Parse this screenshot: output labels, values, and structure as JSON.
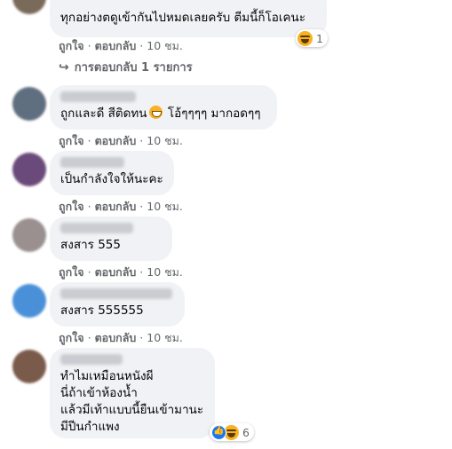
{
  "comments": [
    {
      "text": "ทุกอย่างตดูเข้ากันไปหมดเลยครับ ตีมนี้ก็โอเคนะ",
      "actions": {
        "like": "ถูกใจ",
        "reply": "ตอบกลับ",
        "time": "10 ชม."
      },
      "reaction": {
        "icons": [
          "haha-icon"
        ],
        "count": "1"
      },
      "reply_link": "การตอบกลับ 1 รายการ"
    },
    {
      "text_parts": [
        "ถูกและดี สีติดทน",
        "โอ้ๆๆๆๆ มากอดๆๆ"
      ],
      "actions": {
        "like": "ถูกใจ",
        "reply": "ตอบกลับ",
        "time": "10 ชม."
      }
    },
    {
      "text": "เป็นกำลังใจให้นะคะ",
      "actions": {
        "like": "ถูกใจ",
        "reply": "ตอบกลับ",
        "time": "10 ชม."
      }
    },
    {
      "text": "สงสาร 555",
      "actions": {
        "like": "ถูกใจ",
        "reply": "ตอบกลับ",
        "time": "10 ชม."
      }
    },
    {
      "text": "สงสาร 555555",
      "actions": {
        "like": "ถูกใจ",
        "reply": "ตอบกลับ",
        "time": "10 ชม."
      }
    },
    {
      "lines": [
        "ทำไมเหมือนหนังผี",
        "นี่ถ้าเข้าห้องน้ำ",
        "แล้วมีเท้าแบบนี้ยืนเข้ามานะ",
        "มีปีนกำแพง"
      ],
      "reaction": {
        "icons": [
          "like-icon",
          "haha-icon"
        ],
        "count": "6"
      }
    }
  ],
  "separator": "·",
  "colors": {
    "bubble": "#f0f2f5",
    "meta": "#65676b",
    "text": "#050505",
    "like": "#1877f2",
    "haha": "#f7b125"
  }
}
